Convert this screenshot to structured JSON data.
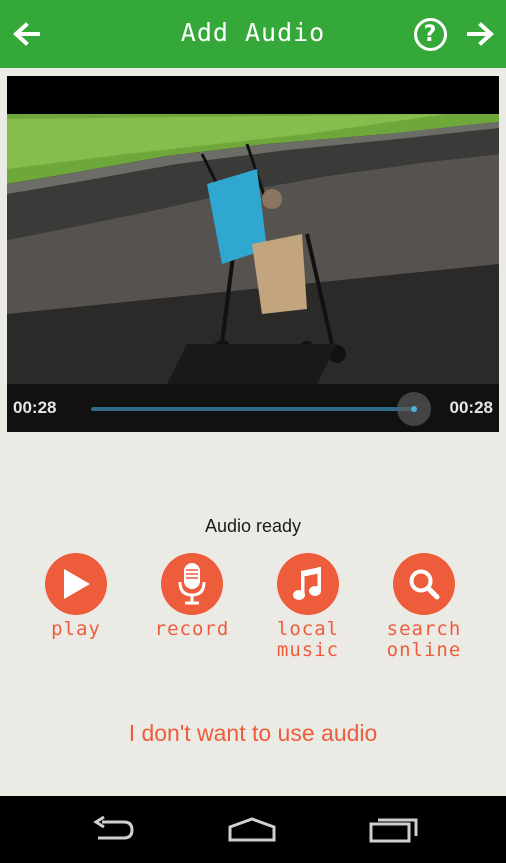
{
  "header": {
    "title": "Add Audio",
    "back_icon": "arrow-left-icon",
    "help_icon": "help-icon",
    "next_icon": "arrow-right-icon",
    "help_glyph": "?",
    "background": "#34a93a"
  },
  "video": {
    "current_time": "00:28",
    "total_time": "00:28",
    "progress": 1.0
  },
  "status": "Audio ready",
  "actions": [
    {
      "label": "play",
      "icon": "play-icon"
    },
    {
      "label": "record",
      "icon": "microphone-icon"
    },
    {
      "label": "local\nmusic",
      "icon": "music-note-icon"
    },
    {
      "label": "search\nonline",
      "icon": "search-icon"
    }
  ],
  "skip_audio_label": "I don't want to use audio",
  "accent_color": "#ee5d3b",
  "navbar": {
    "back_icon": "nav-back-icon",
    "home_icon": "nav-home-icon",
    "recent_icon": "nav-recent-apps-icon"
  }
}
